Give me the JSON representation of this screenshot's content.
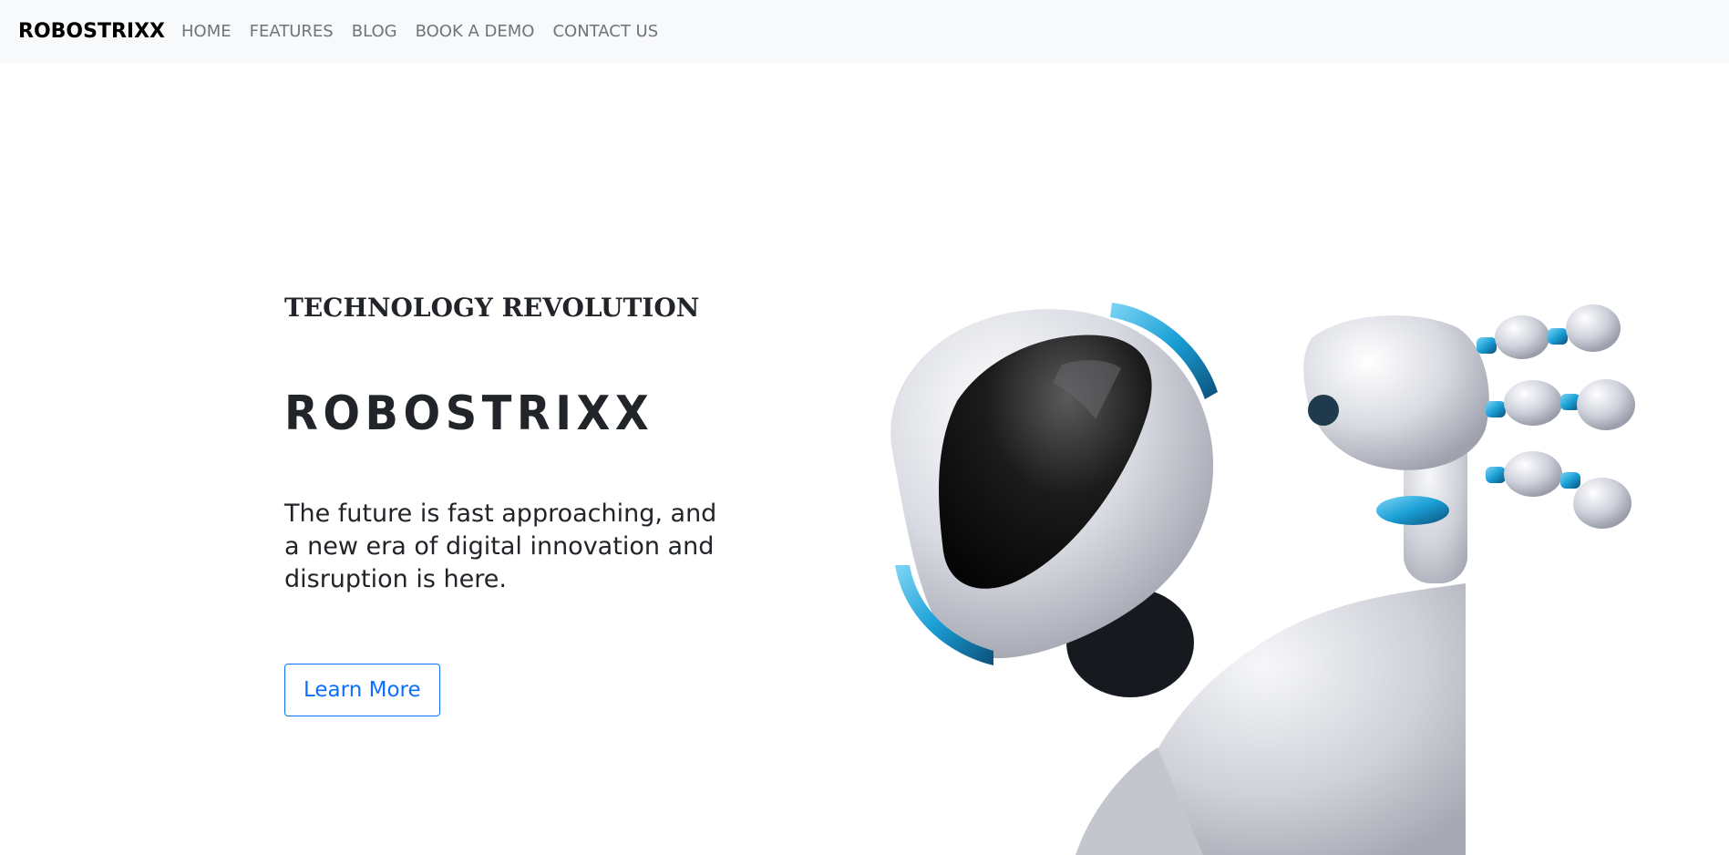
{
  "navbar": {
    "brand": "ROBOSTRIXX",
    "links": [
      "HOME",
      "FEATURES",
      "BLOG",
      "BOOK A DEMO",
      "CONTACT US"
    ]
  },
  "hero": {
    "eyebrow": "TECHNOLOGY REVOLUTION",
    "headline": "ROBOSTRIXX",
    "tagline": "The future is fast approaching, and a new era of digital innovation and disruption is here.",
    "cta_label": "Learn More",
    "image": "robot-peeking-waving-illustration"
  },
  "colors": {
    "navbar_bg": "#f8f9fa",
    "nav_link": "#6c757d",
    "text_dark": "#212529",
    "accent_blue": "#0d6efd",
    "robot_trim": "#1a9fd6"
  }
}
